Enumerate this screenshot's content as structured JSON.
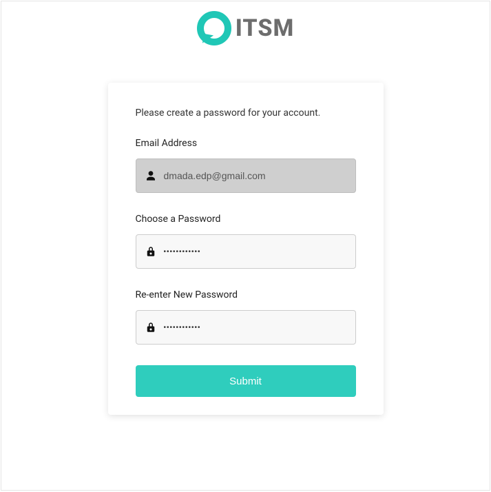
{
  "brand": {
    "name": "ITSM"
  },
  "form": {
    "instruction": "Please create a password for your account.",
    "email": {
      "label": "Email Address",
      "value": "dmada.edp@gmail.com"
    },
    "password": {
      "label": "Choose a Password",
      "value": "••••••••••••"
    },
    "confirm": {
      "label": "Re-enter New Password",
      "value": "••••••••••••"
    },
    "submit_label": "Submit"
  }
}
